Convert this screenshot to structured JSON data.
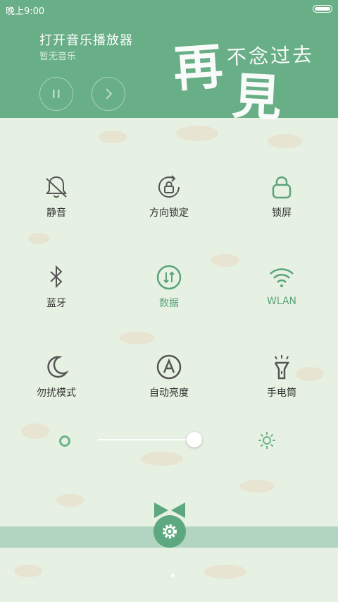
{
  "status_bar": {
    "time": "晚上9:00"
  },
  "player": {
    "title": "打开音乐播放器",
    "subtitle": "暂无音乐",
    "icons": {
      "pause": "pause-icon",
      "next": "chevron-right-icon"
    }
  },
  "calligraphy": {
    "big_char_1": "再",
    "big_char_2": "見",
    "small_text": "不念过去"
  },
  "tiles": [
    {
      "label": "静音",
      "icon": "bell-off-icon",
      "active": false
    },
    {
      "label": "方向锁定",
      "icon": "rotation-lock-icon",
      "active": false
    },
    {
      "label": "锁屏",
      "icon": "lock-icon",
      "active": true
    },
    {
      "label": "蓝牙",
      "icon": "bluetooth-icon",
      "active": false
    },
    {
      "label": "数据",
      "icon": "mobile-data-icon",
      "active": true
    },
    {
      "label": "WLAN",
      "icon": "wifi-icon",
      "active": true
    },
    {
      "label": "勿扰模式",
      "icon": "moon-icon",
      "active": false
    },
    {
      "label": "自动亮度",
      "icon": "auto-brightness-icon",
      "active": false
    },
    {
      "label": "手电筒",
      "icon": "flashlight-icon",
      "active": false
    }
  ],
  "brightness": {
    "level": 0.9
  },
  "colors": {
    "accent": "#68ae86",
    "active_icon": "#5aa47c",
    "inactive_icon": "#555555",
    "background": "#e7f1e3"
  },
  "pager": {
    "current": 1,
    "total": 1
  }
}
